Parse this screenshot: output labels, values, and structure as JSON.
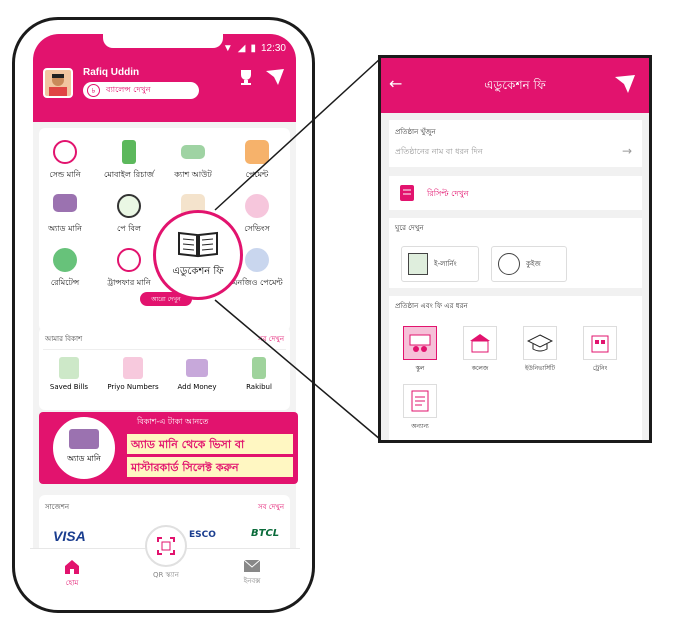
{
  "status": {
    "time": "12:30"
  },
  "user": {
    "name": "Rafiq Uddin",
    "balance_label": "ব্যালেন্স দেখুন",
    "taka": "৳"
  },
  "services": [
    {
      "label": "সেন্ড মানি",
      "icon": "send-money-icon"
    },
    {
      "label": "মোবাইল রিচার্জ",
      "icon": "mobile-recharge-icon"
    },
    {
      "label": "ক্যাশ আউট",
      "icon": "cash-out-icon"
    },
    {
      "label": "পেমেন্ট",
      "icon": "payment-icon"
    },
    {
      "label": "অ্যাড মানি",
      "icon": "add-money-icon"
    },
    {
      "label": "পে বিল",
      "icon": "pay-bill-icon"
    },
    {
      "label": "",
      "icon": "savings-icon"
    },
    {
      "label": "সেভিংস",
      "icon": "savings-bag-icon"
    },
    {
      "label": "রেমিটেন্স",
      "icon": "remittance-icon"
    },
    {
      "label": "ট্রান্সফার মানি",
      "icon": "transfer-money-icon"
    },
    {
      "label": "",
      "icon": "education-icon"
    },
    {
      "label": "এনজিও পেমেন্ট",
      "icon": "ngo-payment-icon"
    }
  ],
  "see_more": "আরো দেখুন",
  "zoom": {
    "label": "এডুকেশন ফি"
  },
  "my_bkash": {
    "title": "আমার বিকাশ",
    "link": "সব দেখুন",
    "items": [
      "Saved Bills",
      "Priyo Numbers",
      "Add Money",
      "Rakibul"
    ]
  },
  "banner": {
    "circle_label": "অ্যাড মানি",
    "line1": "বিকাশ-এ টাকা আনতে",
    "line2": "অ্যাড মানি থেকে ভিসা বা",
    "line3": "মাস্টারকার্ড সিলেক্ট করুন"
  },
  "suggestions": {
    "title": "সাজেশন",
    "link": "সব দেখুন",
    "logos": [
      "VISA",
      "ESCO",
      "BTCL"
    ]
  },
  "nav": {
    "home": "হোম",
    "qr": "QR স্ক্যান",
    "inbox": "ইনবক্স"
  },
  "panel": {
    "title": "এডুকেশন ফি",
    "search_label": "প্রতিষ্ঠান খুঁজুন",
    "search_placeholder": "প্রতিষ্ঠানের নাম বা ধরন দিন",
    "receipt": "রিসিপ্ট দেখুন",
    "explore_title": "ঘুরে দেখুন",
    "elearning": "ই-লার্নিং",
    "quiz": "কুইজ",
    "type_title": "প্রতিষ্ঠান এবং ফি এর ধরন",
    "types": [
      "স্কুল",
      "কলেজ",
      "ইউনিভার্সিটি",
      "ট্রেনিং",
      "অন্যান্য"
    ]
  },
  "colors": {
    "brand": "#e2136e",
    "dark": "#1b1b1b"
  }
}
